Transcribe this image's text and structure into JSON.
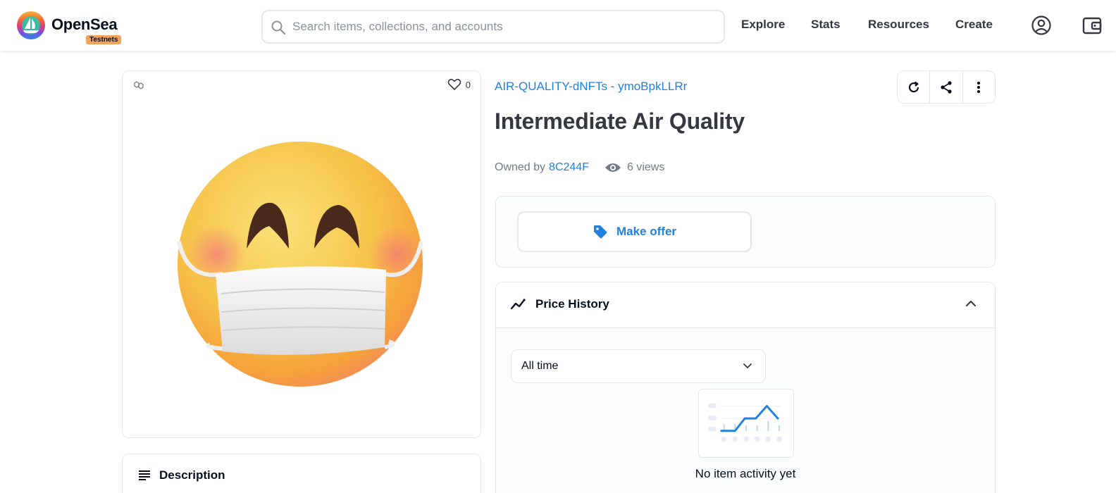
{
  "header": {
    "brand": "OpenSea",
    "badge": "Testnets",
    "search_placeholder": "Search items, collections, and accounts",
    "nav": [
      "Explore",
      "Stats",
      "Resources",
      "Create"
    ],
    "icons": [
      "search-icon",
      "account-icon",
      "wallet-icon"
    ]
  },
  "asset": {
    "favorites": "0",
    "collection": "AIR-QUALITY-dNFTs - ymoBpkLLRr",
    "title": "Intermediate Air Quality",
    "owned_by_label": "Owned by",
    "owner": "8C244F",
    "views": "6 views"
  },
  "offer": {
    "label": "Make offer"
  },
  "price_history": {
    "title": "Price History",
    "range": "All time",
    "empty": "No item activity yet"
  },
  "description": {
    "title": "Description"
  },
  "colors": {
    "accent": "#2081e2",
    "text": "#353840",
    "border": "#e5e8eb",
    "badge": "#f5a25d"
  }
}
